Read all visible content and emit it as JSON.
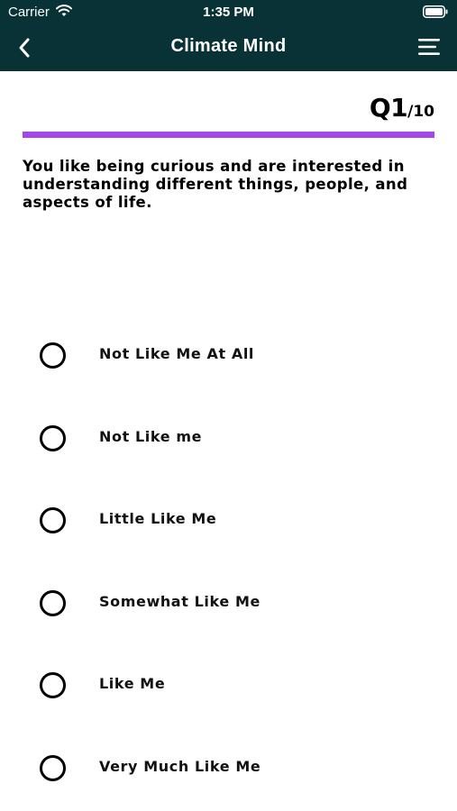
{
  "status_bar": {
    "carrier": "Carrier",
    "time": "1:35 PM"
  },
  "header": {
    "title": "Climate Mind",
    "background": "#083235",
    "back_icon": "chevron-left-icon",
    "menu_icon": "hamburger-menu-icon"
  },
  "quiz": {
    "question_number": "Q1",
    "question_total": "/10",
    "progress_fraction": 1.0,
    "progress_color": "#a347e8",
    "question_text": "You like being curious and are interested in understanding different things, people, and aspects of life.",
    "options": [
      {
        "label": "Not Like Me At All",
        "selected": false
      },
      {
        "label": "Not Like me",
        "selected": false
      },
      {
        "label": "Little Like Me",
        "selected": false
      },
      {
        "label": "Somewhat Like Me",
        "selected": false
      },
      {
        "label": "Like Me",
        "selected": false
      },
      {
        "label": "Very Much Like Me",
        "selected": false
      }
    ]
  }
}
